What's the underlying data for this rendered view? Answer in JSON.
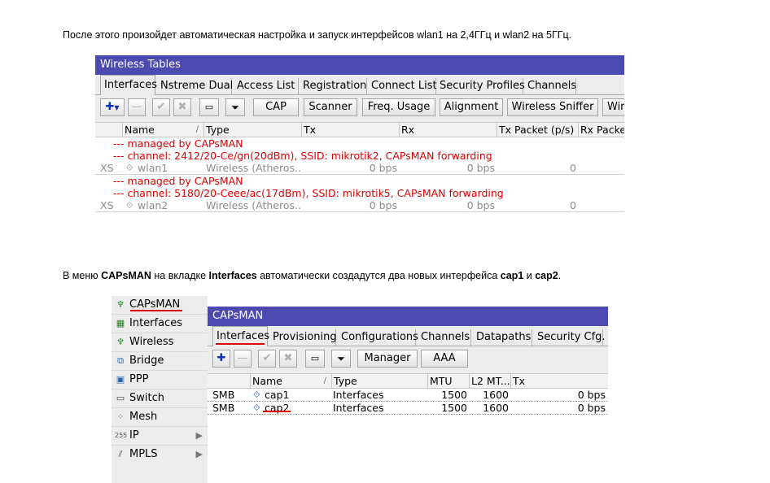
{
  "para1": "После этого произойдет автоматическая настройка и запуск интерфейсов wlan1 на 2,4ГГц и wlan2 на 5ГГц.",
  "para2": {
    "t1": "В меню ",
    "b1": "CAPsMAN",
    "t2": " на вкладке ",
    "b2": "Interfaces",
    "t3": " автоматически создадутся два новых интерфейса ",
    "b3": "cap1",
    "t4": " и ",
    "b4": "cap2",
    "t5": "."
  },
  "wireless": {
    "title": "Wireless Tables",
    "tabs": [
      "Interfaces",
      "Nstreme Dual",
      "Access List",
      "Registration",
      "Connect List",
      "Security Profiles",
      "Channels"
    ],
    "buttons": [
      "CAP",
      "Scanner",
      "Freq. Usage",
      "Alignment",
      "Wireless Sniffer",
      "Wir"
    ],
    "columns": [
      "Name",
      "Type",
      "Tx",
      "Rx",
      "Tx Packet (p/s)",
      "Rx Packe"
    ],
    "rows": [
      {
        "comment1": "--- managed by CAPsMAN",
        "comment2": "--- channel: 2412/20-Ce/gn(20dBm), SSID: mikrotik2, CAPsMAN forwarding",
        "flags": "XS",
        "name": "wlan1",
        "type": "Wireless (Atheros...",
        "tx": "0 bps",
        "rx": "0 bps",
        "txp": "0"
      },
      {
        "comment1": "--- managed by CAPsMAN",
        "comment2": "--- channel: 5180/20-Ceee/ac(17dBm), SSID: mikrotik5, CAPsMAN forwarding",
        "flags": "XS",
        "name": "wlan2",
        "type": "Wireless (Atheros...",
        "tx": "0 bps",
        "rx": "0 bps",
        "txp": "0"
      }
    ]
  },
  "sidebar": {
    "items": [
      {
        "label": "CAPsMAN",
        "icon": "antenna-icon"
      },
      {
        "label": "Interfaces",
        "icon": "interfaces-icon"
      },
      {
        "label": "Wireless",
        "icon": "antenna-icon"
      },
      {
        "label": "Bridge",
        "icon": "bridge-icon"
      },
      {
        "label": "PPP",
        "icon": "ppp-icon"
      },
      {
        "label": "Switch",
        "icon": "switch-icon"
      },
      {
        "label": "Mesh",
        "icon": "mesh-icon"
      },
      {
        "label": "IP",
        "icon": "ip-icon"
      },
      {
        "label": "MPLS",
        "icon": "mpls-icon"
      }
    ]
  },
  "capsman": {
    "title": "CAPsMAN",
    "tabs": [
      "Interfaces",
      "Provisioning",
      "Configurations",
      "Channels",
      "Datapaths",
      "Security Cfg."
    ],
    "buttons": [
      "Manager",
      "AAA"
    ],
    "columns": [
      "Name",
      "Type",
      "MTU",
      "L2 MT...",
      "Tx"
    ],
    "rows": [
      {
        "flags": "SMB",
        "name": "cap1",
        "type": "Interfaces",
        "mtu": "1500",
        "l2mtu": "1600",
        "tx": "0 bps"
      },
      {
        "flags": "SMB",
        "name": "cap2",
        "type": "Interfaces",
        "mtu": "1500",
        "l2mtu": "1600",
        "tx": "0 bps"
      }
    ]
  }
}
